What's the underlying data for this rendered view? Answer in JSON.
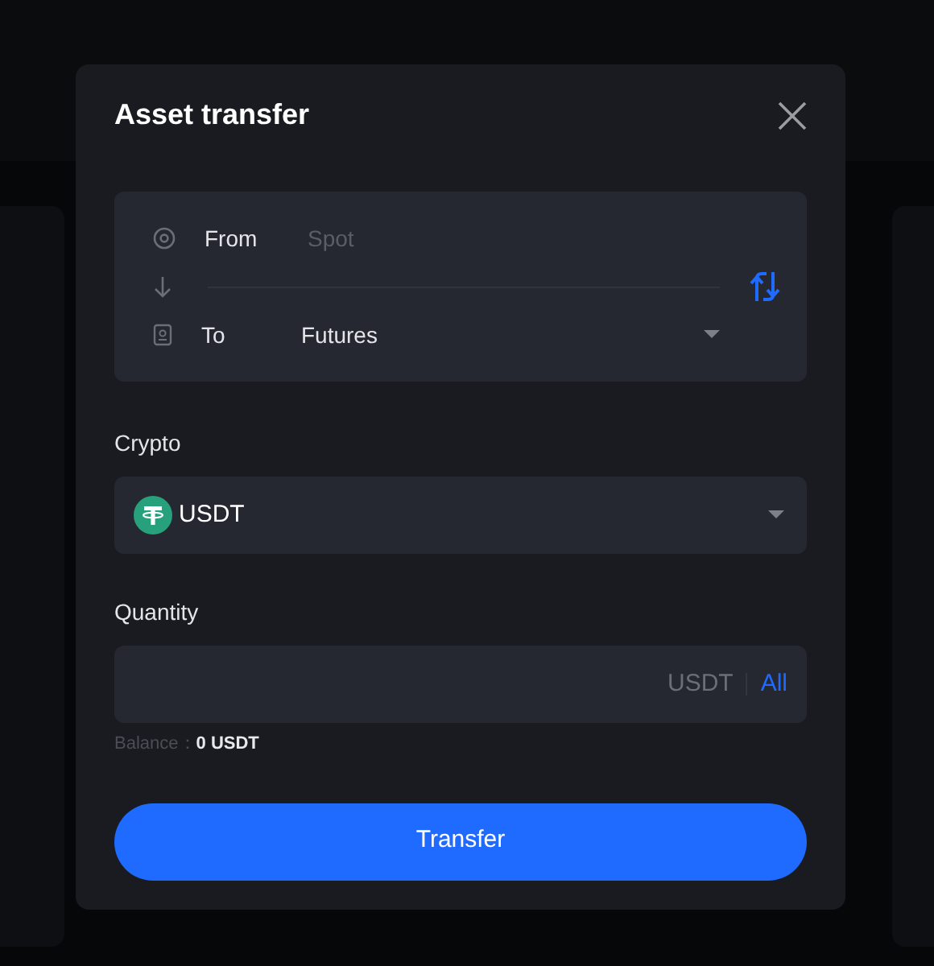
{
  "dialog": {
    "title": "Asset transfer",
    "from": {
      "label": "From",
      "placeholder": "Spot"
    },
    "to": {
      "label": "To",
      "value": "Futures"
    },
    "crypto": {
      "label": "Crypto",
      "value": "USDT"
    },
    "quantity": {
      "label": "Quantity",
      "unit": "USDT",
      "max_link": "All"
    },
    "balance": {
      "label": "Balance：",
      "value": "0 USDT"
    },
    "submit": "Transfer"
  }
}
